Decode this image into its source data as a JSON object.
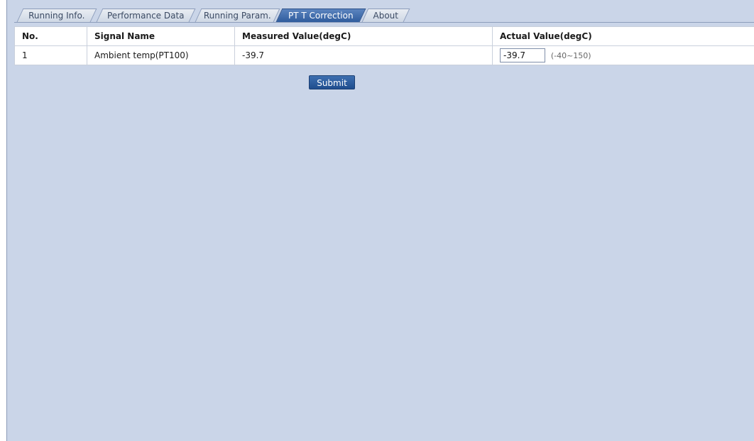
{
  "tabs": [
    {
      "label": "Running Info.",
      "active": false
    },
    {
      "label": "Performance Data",
      "active": false
    },
    {
      "label": "Running Param.",
      "active": false
    },
    {
      "label": "PT T Correction",
      "active": true
    },
    {
      "label": "About",
      "active": false
    }
  ],
  "table": {
    "headers": [
      "No.",
      "Signal Name",
      "Measured Value(degC)",
      "Actual Value(degC)"
    ],
    "rows": [
      {
        "no": "1",
        "signal_name": "Ambient temp(PT100)",
        "measured_value": "-39.7",
        "actual_value": "-39.7",
        "range": "(-40~150)"
      }
    ]
  },
  "submit_label": "Submit",
  "colors": {
    "background": "#cad5e8",
    "active_tab": "#2f5c9d",
    "button": "#2a5a9c"
  },
  "icons": {
    "collapse_handle": "chevron-left-icon"
  }
}
